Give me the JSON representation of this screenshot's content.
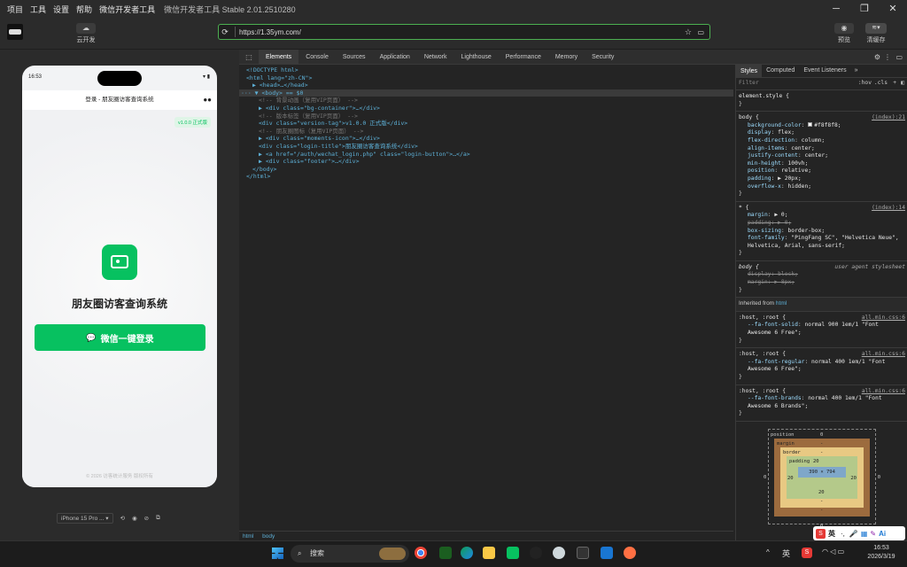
{
  "titlebar": {
    "menu": [
      "项目",
      "工具",
      "设置",
      "帮助",
      "微信开发者工具"
    ],
    "title": "微信开发者工具 Stable 2.01.2510280"
  },
  "toolbar": {
    "cloud_label": "云开发",
    "url": "https://1.35ym.com/",
    "preview_label": "预览",
    "clear_cache_label": "清缓存"
  },
  "phone": {
    "time": "16:53",
    "nav_title": "登录 - 朋友圈访客查询系统",
    "version": "v1.0.0 正式版",
    "app_title": "朋友圈访客查询系统",
    "login_button": "微信一键登录",
    "footer": "© 2026 访客统计服务 版权所有"
  },
  "simulator": {
    "device_label": "iPhone 15 Pro ...",
    "device_menu_arrow": "▾"
  },
  "devtools": {
    "tabs": [
      "Elements",
      "Console",
      "Sources",
      "Application",
      "Network",
      "Lighthouse",
      "Performance",
      "Memory",
      "Security"
    ],
    "active_tab": "Elements",
    "dom_lines": [
      {
        "t": "<!DOCTYPE html>"
      },
      {
        "t": "<html lang=\"zh-CN\">"
      },
      {
        "t": "▶ <head>…</head>"
      },
      {
        "t": "··· ▼ <body> == $0",
        "selected": true
      },
      {
        "t": "<!-- 背景动画（复用VIP页面） -->",
        "comment": true
      },
      {
        "t": "▶ <div class=\"bg-container\">…</div>"
      },
      {
        "t": "<!-- 版本标签（复用VIP页面） -->",
        "comment": true
      },
      {
        "t": "<div class=\"version-tag\">v1.0.0 正式版</div>"
      },
      {
        "t": "<!-- 朋友圈图标（复用VIP页面） -->",
        "comment": true
      },
      {
        "t": "▶ <div class=\"moments-icon\">…</div>"
      },
      {
        "t": "<div class=\"login-title\">朋友圈访客查询系统</div>"
      },
      {
        "t": "▶ <a href=\"/auth/wechat_login.php\" class=\"login-button\">…</a>"
      },
      {
        "t": "▶ <div class=\"footer\">…</div>"
      },
      {
        "t": "</body>"
      },
      {
        "t": "</html>"
      }
    ],
    "breadcrumb": [
      "html",
      "body"
    ],
    "styles_tabs": [
      "Styles",
      "Computed",
      "Event Listeners",
      "»"
    ],
    "filter_placeholder": "Filter",
    "filter_tools": [
      ":hov",
      ".cls",
      "+"
    ],
    "element_style": "element.style {",
    "close_brace": "}",
    "inherited_label": "Inherited from",
    "inherited_tag": "html",
    "rules": [
      {
        "selector": "body {",
        "source": "(index):21",
        "props": [
          [
            "background-color",
            "#f8f8f8;"
          ],
          [
            "display",
            "flex;"
          ],
          [
            "flex-direction",
            "column;"
          ],
          [
            "align-items",
            "center;"
          ],
          [
            "justify-content",
            "center;"
          ],
          [
            "min-height",
            "100vh;"
          ],
          [
            "position",
            "relative;"
          ],
          [
            "padding",
            "▶ 20px;"
          ],
          [
            "overflow-x",
            "hidden;"
          ]
        ]
      },
      {
        "selector": "* {",
        "source": "(index):14",
        "props": [
          [
            "margin",
            "▶ 0;"
          ],
          [
            "padding",
            "▶ 0;"
          ],
          [
            "box-sizing",
            "border-box;"
          ],
          [
            "font-family",
            "\"PingFang SC\", \"Helvetica Neue\", Helvetica, Arial, sans-serif;"
          ]
        ]
      },
      {
        "selector": "body {",
        "source": "user agent stylesheet",
        "props": [
          [
            "display",
            "block;"
          ],
          [
            "margin",
            "▶ 8px;"
          ]
        ]
      },
      {
        "selector": ":host, :root {",
        "source": "all.min.css:6",
        "props": [
          [
            "--fa-font-solid",
            "normal 900 1em/1 \"Font Awesome 6 Free\";"
          ]
        ]
      },
      {
        "selector": ":host, :root {",
        "source": "all.min.css:6",
        "props": [
          [
            "--fa-font-regular",
            "normal 400 1em/1 \"Font Awesome 6 Free\";"
          ]
        ]
      },
      {
        "selector": ":host, :root {",
        "source": "all.min.css:6",
        "props": [
          [
            "--fa-font-brands",
            "normal 400 1em/1 \"Font Awesome 6 Brands\";"
          ]
        ]
      }
    ],
    "boxmodel": {
      "position_label": "position",
      "margin_label": "margin",
      "border_label": "border",
      "padding_label": "padding",
      "position": "0",
      "margin": "-",
      "border": "-",
      "padding": "20",
      "content": "390 × 794",
      "zero": "0",
      "dash": "-"
    }
  },
  "taskbar": {
    "search": "搜索",
    "ime": "英",
    "time": "16:53",
    "date": "2026/3/19",
    "sogou_ime": "英"
  },
  "colors": {
    "accent": "#07c160",
    "url_border": "#4caf50"
  }
}
